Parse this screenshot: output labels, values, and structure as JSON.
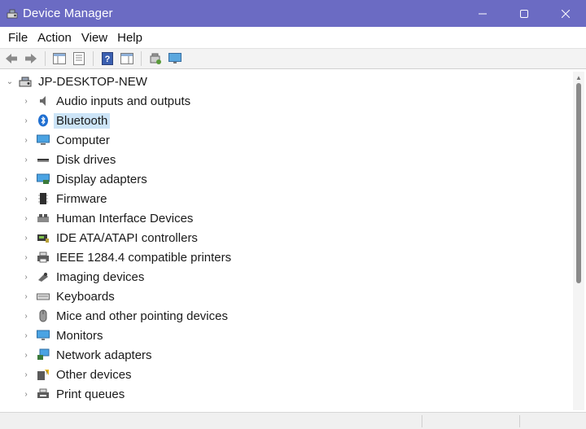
{
  "window": {
    "title": "Device Manager",
    "minimize": "—",
    "maximize": "☐",
    "close": "✕"
  },
  "menu": {
    "file": "File",
    "action": "Action",
    "view": "View",
    "help": "Help"
  },
  "tree": {
    "root": "JP-DESKTOP-NEW",
    "items": [
      {
        "label": "Audio inputs and outputs",
        "icon": "speaker-icon"
      },
      {
        "label": "Bluetooth",
        "icon": "bluetooth-icon",
        "selected": true
      },
      {
        "label": "Computer",
        "icon": "computer-icon"
      },
      {
        "label": "Disk drives",
        "icon": "disk-drive-icon"
      },
      {
        "label": "Display adapters",
        "icon": "display-adapter-icon"
      },
      {
        "label": "Firmware",
        "icon": "firmware-icon"
      },
      {
        "label": "Human Interface Devices",
        "icon": "hid-icon"
      },
      {
        "label": "IDE ATA/ATAPI controllers",
        "icon": "ide-controller-icon"
      },
      {
        "label": "IEEE 1284.4 compatible printers",
        "icon": "printer-icon"
      },
      {
        "label": "Imaging devices",
        "icon": "camera-icon"
      },
      {
        "label": "Keyboards",
        "icon": "keyboard-icon"
      },
      {
        "label": "Mice and other pointing devices",
        "icon": "mouse-icon"
      },
      {
        "label": "Monitors",
        "icon": "monitor-icon"
      },
      {
        "label": "Network adapters",
        "icon": "network-adapter-icon"
      },
      {
        "label": "Other devices",
        "icon": "unknown-device-icon"
      },
      {
        "label": "Print queues",
        "icon": "print-queue-icon"
      }
    ]
  },
  "colors": {
    "titlebar": "#6b6bc3",
    "selection": "#cce4f7"
  }
}
